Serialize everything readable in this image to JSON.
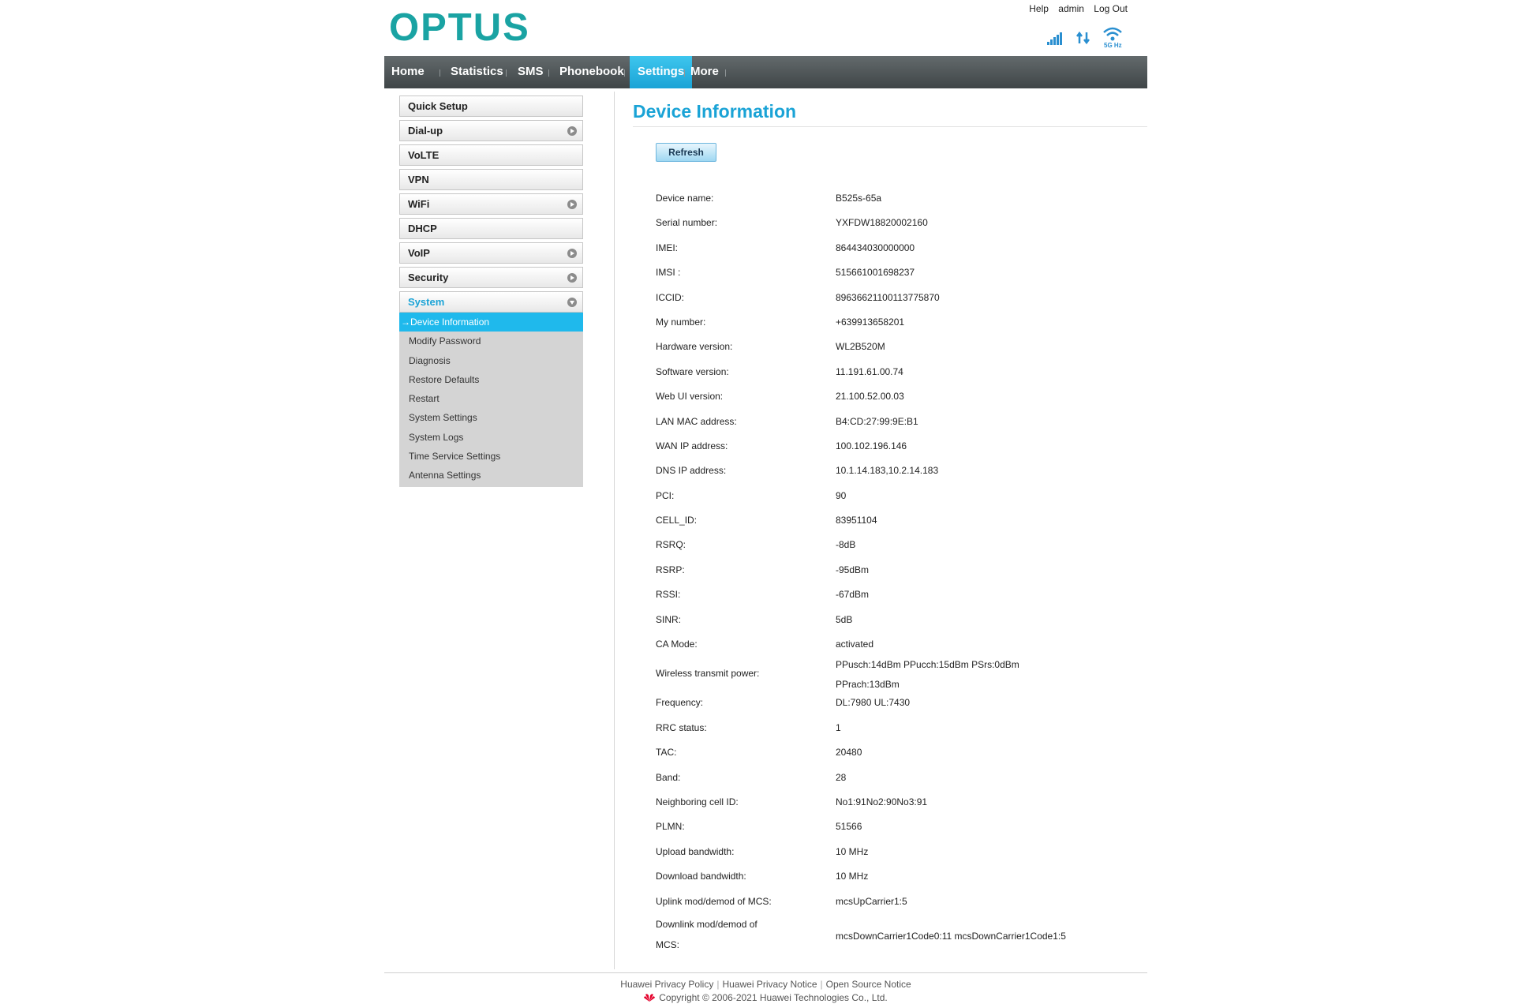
{
  "header": {
    "logo": "OPTUS",
    "links": {
      "help": "Help",
      "user": "admin",
      "logout": "Log Out"
    },
    "status": {
      "network_band": "5G Hz"
    }
  },
  "nav": {
    "items": [
      "Home",
      "Statistics",
      "SMS",
      "Phonebook",
      "Settings",
      "More"
    ],
    "active": "Settings"
  },
  "sidebar": {
    "items": [
      "Quick Setup",
      "Dial-up",
      "VoLTE",
      "VPN",
      "WiFi",
      "DHCP",
      "VoIP",
      "Security",
      "System"
    ],
    "submenu": {
      "active_prefix": "→",
      "items": [
        "Device Information",
        "Modify Password",
        "Diagnosis",
        "Restore Defaults",
        "Restart",
        "System Settings",
        "System Logs",
        "Time Service Settings",
        "Antenna Settings"
      ]
    }
  },
  "main": {
    "title": "Device Information",
    "refresh_label": "Refresh",
    "rows": [
      {
        "label": "Device name:",
        "value": "B525s-65a"
      },
      {
        "label": "Serial number:",
        "value": "YXFDW18820002160"
      },
      {
        "label": "IMEI:",
        "value": "864434030000000"
      },
      {
        "label": "IMSI :",
        "value": "515661001698237"
      },
      {
        "label": "ICCID:",
        "value": "89636621100113775870"
      },
      {
        "label": "My number:",
        "value": "+639913658201"
      },
      {
        "label": "Hardware version:",
        "value": "WL2B520M"
      },
      {
        "label": "Software version:",
        "value": "11.191.61.00.74"
      },
      {
        "label": "Web UI version:",
        "value": "21.100.52.00.03"
      },
      {
        "label": "LAN MAC address:",
        "value": "B4:CD:27:99:9E:B1"
      },
      {
        "label": "WAN IP address:",
        "value": "100.102.196.146"
      },
      {
        "label": "DNS IP address:",
        "value": "10.1.14.183,10.2.14.183"
      },
      {
        "label": "PCI:",
        "value": "90"
      },
      {
        "label": "CELL_ID:",
        "value": "83951104"
      },
      {
        "label": "RSRQ:",
        "value": "-8dB"
      },
      {
        "label": "RSRP:",
        "value": "-95dBm"
      },
      {
        "label": "RSSI:",
        "value": "-67dBm"
      },
      {
        "label": "SINR:",
        "value": "5dB"
      },
      {
        "label": "CA Mode:",
        "value": "activated"
      }
    ],
    "wireless_row": {
      "label": "Wireless transmit power:",
      "value_line1": "PPusch:14dBm PPucch:15dBm PSrs:0dBm",
      "value_line2": "PPrach:13dBm"
    },
    "rows2": [
      {
        "label": "Frequency:",
        "value": "DL:7980 UL:7430"
      },
      {
        "label": "RRC status:",
        "value": "1"
      },
      {
        "label": "TAC:",
        "value": "20480"
      },
      {
        "label": "Band:",
        "value": "28"
      },
      {
        "label": "Neighboring cell ID:",
        "value": "No1:91No2:90No3:91"
      },
      {
        "label": "PLMN:",
        "value": "51566"
      },
      {
        "label": "Upload bandwidth:",
        "value": "10 MHz"
      },
      {
        "label": "Download bandwidth:",
        "value": "10 MHz"
      },
      {
        "label": "Uplink mod/demod of MCS:",
        "value": "mcsUpCarrier1:5"
      }
    ],
    "downlink_row": {
      "label": "Downlink mod/demod of MCS:",
      "value": "mcsDownCarrier1Code0:11 mcsDownCarrier1Code1:5"
    }
  },
  "footer": {
    "links": [
      "Huawei Privacy Policy",
      "Huawei Privacy Notice",
      "Open Source Notice"
    ],
    "copyright": "Copyright © 2006-2021 Huawei Technologies Co., Ltd."
  },
  "colors": {
    "accent": "#1aa3d6",
    "logo": "#1aa3a3",
    "nav_bg": "#4a5153",
    "active_sub": "#1fb9ec"
  }
}
